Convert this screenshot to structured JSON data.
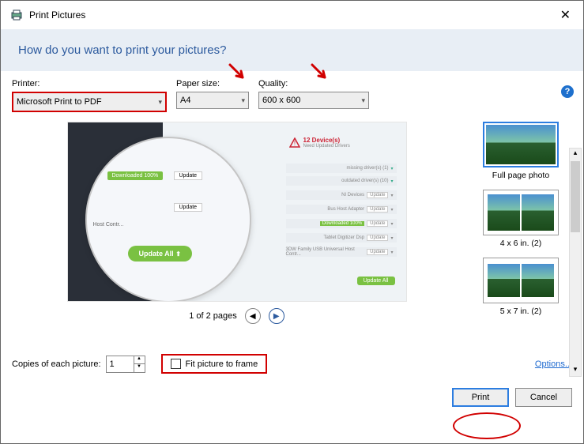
{
  "window": {
    "title": "Print Pictures"
  },
  "header": {
    "question": "How do you want to print your pictures?"
  },
  "controls": {
    "printer_label": "Printer:",
    "printer_value": "Microsoft Print to PDF",
    "paper_label": "Paper size:",
    "paper_value": "A4",
    "quality_label": "Quality:",
    "quality_value": "600 x 600"
  },
  "preview": {
    "badge": "Downloaded 100%",
    "alert_count": "12 Device(s)",
    "alert_line": "Need Updated Drivers",
    "update_btn": "Update",
    "update_all": "Update All",
    "row_text": "Update",
    "host_contr": "Host Contr..."
  },
  "pager": {
    "text": "1 of 2 pages"
  },
  "layouts": {
    "full": "Full page photo",
    "l4x6": "4 x 6 in. (2)",
    "l5x7": "5 x 7 in. (2)"
  },
  "bottom": {
    "copies_label": "Copies of each picture:",
    "copies_value": "1",
    "fit_label": "Fit picture to frame",
    "options": "Options..."
  },
  "buttons": {
    "print": "Print",
    "cancel": "Cancel"
  }
}
